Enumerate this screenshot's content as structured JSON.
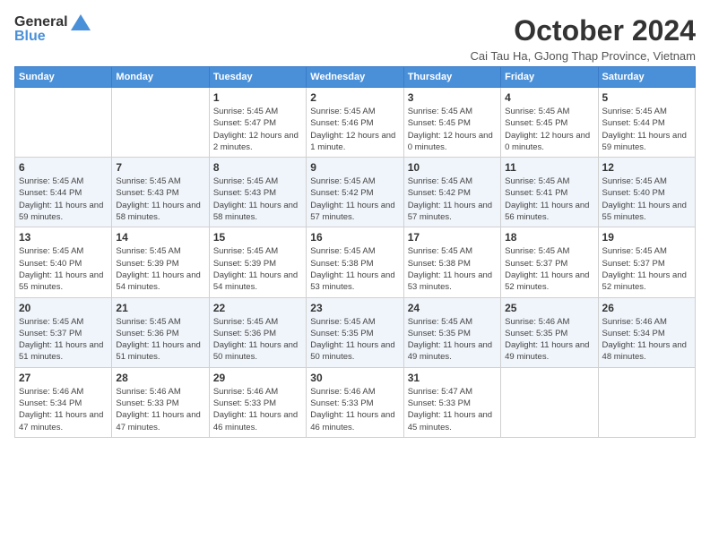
{
  "logo": {
    "text_general": "General",
    "text_blue": "Blue"
  },
  "header": {
    "month": "October 2024",
    "location": "Cai Tau Ha, GJong Thap Province, Vietnam"
  },
  "days_header": [
    "Sunday",
    "Monday",
    "Tuesday",
    "Wednesday",
    "Thursday",
    "Friday",
    "Saturday"
  ],
  "weeks": [
    [
      {
        "day": "",
        "sunrise": "",
        "sunset": "",
        "daylight": ""
      },
      {
        "day": "",
        "sunrise": "",
        "sunset": "",
        "daylight": ""
      },
      {
        "day": "1",
        "sunrise": "Sunrise: 5:45 AM",
        "sunset": "Sunset: 5:47 PM",
        "daylight": "Daylight: 12 hours and 2 minutes."
      },
      {
        "day": "2",
        "sunrise": "Sunrise: 5:45 AM",
        "sunset": "Sunset: 5:46 PM",
        "daylight": "Daylight: 12 hours and 1 minute."
      },
      {
        "day": "3",
        "sunrise": "Sunrise: 5:45 AM",
        "sunset": "Sunset: 5:45 PM",
        "daylight": "Daylight: 12 hours and 0 minutes."
      },
      {
        "day": "4",
        "sunrise": "Sunrise: 5:45 AM",
        "sunset": "Sunset: 5:45 PM",
        "daylight": "Daylight: 12 hours and 0 minutes."
      },
      {
        "day": "5",
        "sunrise": "Sunrise: 5:45 AM",
        "sunset": "Sunset: 5:44 PM",
        "daylight": "Daylight: 11 hours and 59 minutes."
      }
    ],
    [
      {
        "day": "6",
        "sunrise": "Sunrise: 5:45 AM",
        "sunset": "Sunset: 5:44 PM",
        "daylight": "Daylight: 11 hours and 59 minutes."
      },
      {
        "day": "7",
        "sunrise": "Sunrise: 5:45 AM",
        "sunset": "Sunset: 5:43 PM",
        "daylight": "Daylight: 11 hours and 58 minutes."
      },
      {
        "day": "8",
        "sunrise": "Sunrise: 5:45 AM",
        "sunset": "Sunset: 5:43 PM",
        "daylight": "Daylight: 11 hours and 58 minutes."
      },
      {
        "day": "9",
        "sunrise": "Sunrise: 5:45 AM",
        "sunset": "Sunset: 5:42 PM",
        "daylight": "Daylight: 11 hours and 57 minutes."
      },
      {
        "day": "10",
        "sunrise": "Sunrise: 5:45 AM",
        "sunset": "Sunset: 5:42 PM",
        "daylight": "Daylight: 11 hours and 57 minutes."
      },
      {
        "day": "11",
        "sunrise": "Sunrise: 5:45 AM",
        "sunset": "Sunset: 5:41 PM",
        "daylight": "Daylight: 11 hours and 56 minutes."
      },
      {
        "day": "12",
        "sunrise": "Sunrise: 5:45 AM",
        "sunset": "Sunset: 5:40 PM",
        "daylight": "Daylight: 11 hours and 55 minutes."
      }
    ],
    [
      {
        "day": "13",
        "sunrise": "Sunrise: 5:45 AM",
        "sunset": "Sunset: 5:40 PM",
        "daylight": "Daylight: 11 hours and 55 minutes."
      },
      {
        "day": "14",
        "sunrise": "Sunrise: 5:45 AM",
        "sunset": "Sunset: 5:39 PM",
        "daylight": "Daylight: 11 hours and 54 minutes."
      },
      {
        "day": "15",
        "sunrise": "Sunrise: 5:45 AM",
        "sunset": "Sunset: 5:39 PM",
        "daylight": "Daylight: 11 hours and 54 minutes."
      },
      {
        "day": "16",
        "sunrise": "Sunrise: 5:45 AM",
        "sunset": "Sunset: 5:38 PM",
        "daylight": "Daylight: 11 hours and 53 minutes."
      },
      {
        "day": "17",
        "sunrise": "Sunrise: 5:45 AM",
        "sunset": "Sunset: 5:38 PM",
        "daylight": "Daylight: 11 hours and 53 minutes."
      },
      {
        "day": "18",
        "sunrise": "Sunrise: 5:45 AM",
        "sunset": "Sunset: 5:37 PM",
        "daylight": "Daylight: 11 hours and 52 minutes."
      },
      {
        "day": "19",
        "sunrise": "Sunrise: 5:45 AM",
        "sunset": "Sunset: 5:37 PM",
        "daylight": "Daylight: 11 hours and 52 minutes."
      }
    ],
    [
      {
        "day": "20",
        "sunrise": "Sunrise: 5:45 AM",
        "sunset": "Sunset: 5:37 PM",
        "daylight": "Daylight: 11 hours and 51 minutes."
      },
      {
        "day": "21",
        "sunrise": "Sunrise: 5:45 AM",
        "sunset": "Sunset: 5:36 PM",
        "daylight": "Daylight: 11 hours and 51 minutes."
      },
      {
        "day": "22",
        "sunrise": "Sunrise: 5:45 AM",
        "sunset": "Sunset: 5:36 PM",
        "daylight": "Daylight: 11 hours and 50 minutes."
      },
      {
        "day": "23",
        "sunrise": "Sunrise: 5:45 AM",
        "sunset": "Sunset: 5:35 PM",
        "daylight": "Daylight: 11 hours and 50 minutes."
      },
      {
        "day": "24",
        "sunrise": "Sunrise: 5:45 AM",
        "sunset": "Sunset: 5:35 PM",
        "daylight": "Daylight: 11 hours and 49 minutes."
      },
      {
        "day": "25",
        "sunrise": "Sunrise: 5:46 AM",
        "sunset": "Sunset: 5:35 PM",
        "daylight": "Daylight: 11 hours and 49 minutes."
      },
      {
        "day": "26",
        "sunrise": "Sunrise: 5:46 AM",
        "sunset": "Sunset: 5:34 PM",
        "daylight": "Daylight: 11 hours and 48 minutes."
      }
    ],
    [
      {
        "day": "27",
        "sunrise": "Sunrise: 5:46 AM",
        "sunset": "Sunset: 5:34 PM",
        "daylight": "Daylight: 11 hours and 47 minutes."
      },
      {
        "day": "28",
        "sunrise": "Sunrise: 5:46 AM",
        "sunset": "Sunset: 5:33 PM",
        "daylight": "Daylight: 11 hours and 47 minutes."
      },
      {
        "day": "29",
        "sunrise": "Sunrise: 5:46 AM",
        "sunset": "Sunset: 5:33 PM",
        "daylight": "Daylight: 11 hours and 46 minutes."
      },
      {
        "day": "30",
        "sunrise": "Sunrise: 5:46 AM",
        "sunset": "Sunset: 5:33 PM",
        "daylight": "Daylight: 11 hours and 46 minutes."
      },
      {
        "day": "31",
        "sunrise": "Sunrise: 5:47 AM",
        "sunset": "Sunset: 5:33 PM",
        "daylight": "Daylight: 11 hours and 45 minutes."
      },
      {
        "day": "",
        "sunrise": "",
        "sunset": "",
        "daylight": ""
      },
      {
        "day": "",
        "sunrise": "",
        "sunset": "",
        "daylight": ""
      }
    ]
  ]
}
